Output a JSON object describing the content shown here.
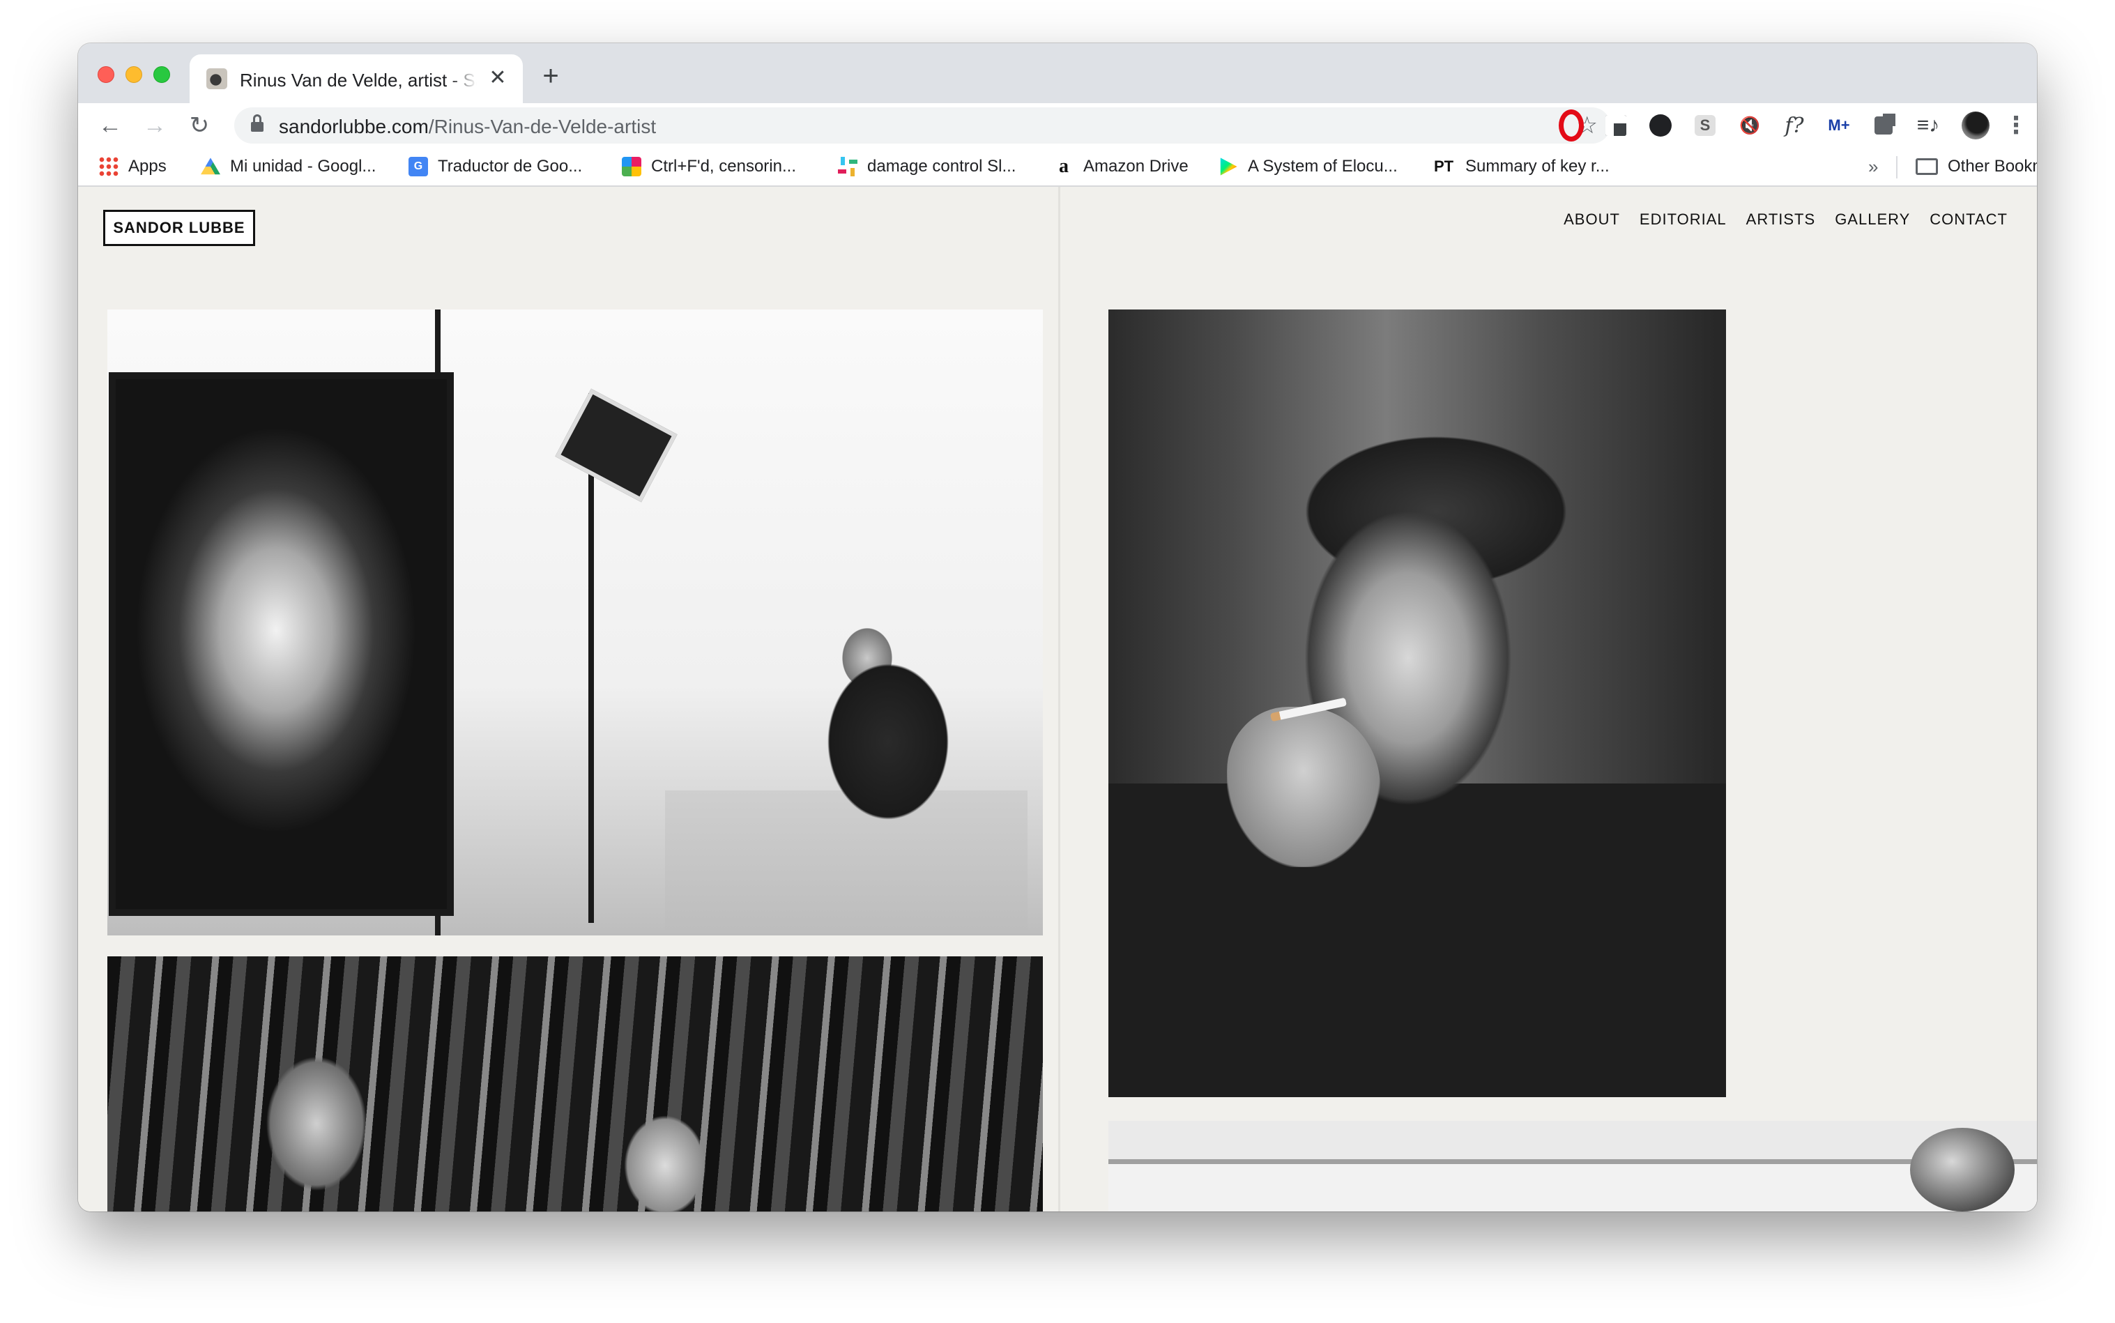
{
  "browser": {
    "tab": {
      "title": "Rinus Van de Velde, artist - Sandor Lubbe",
      "close_glyph": "✕"
    },
    "new_tab_glyph": "+",
    "nav": {
      "back": "←",
      "forward": "→",
      "reload": "↻"
    },
    "address": {
      "host": "sandorlubbe.com",
      "path": "/Rinus-Van-de-Velde-artist"
    },
    "bookmark_star": "☆",
    "extensions": {
      "speaker": "🔇",
      "f": "f?",
      "m": "M+",
      "media": "≡♪"
    },
    "menu_glyph": "⋮",
    "bookmarks": [
      {
        "label": "Apps",
        "icon": "apps-grid-icon"
      },
      {
        "label": "Mi unidad - Googl...",
        "icon": "google-drive-icon"
      },
      {
        "label": "Traductor de Goo...",
        "icon": "google-translate-icon"
      },
      {
        "label": "Ctrl+F'd, censorin...",
        "icon": "ctrlf-icon"
      },
      {
        "label": "damage control Sl...",
        "icon": "slack-icon"
      },
      {
        "label": "Amazon Drive",
        "icon": "amazon-icon"
      },
      {
        "label": "A System of Elocu...",
        "icon": "google-play-icon"
      },
      {
        "label": "Summary of key r...",
        "icon": "pt-icon"
      }
    ],
    "bookmark_icon_glyphs": {
      "translate": "G",
      "amazon": "a",
      "pt": "PT"
    },
    "bookmarks_more": "»",
    "other_bookmarks": "Other Bookmarks"
  },
  "site": {
    "logo": "SANDOR LUBBE",
    "nav": [
      "ABOUT",
      "EDITORIAL",
      "ARTISTS",
      "GALLERY",
      "CONTACT"
    ]
  }
}
